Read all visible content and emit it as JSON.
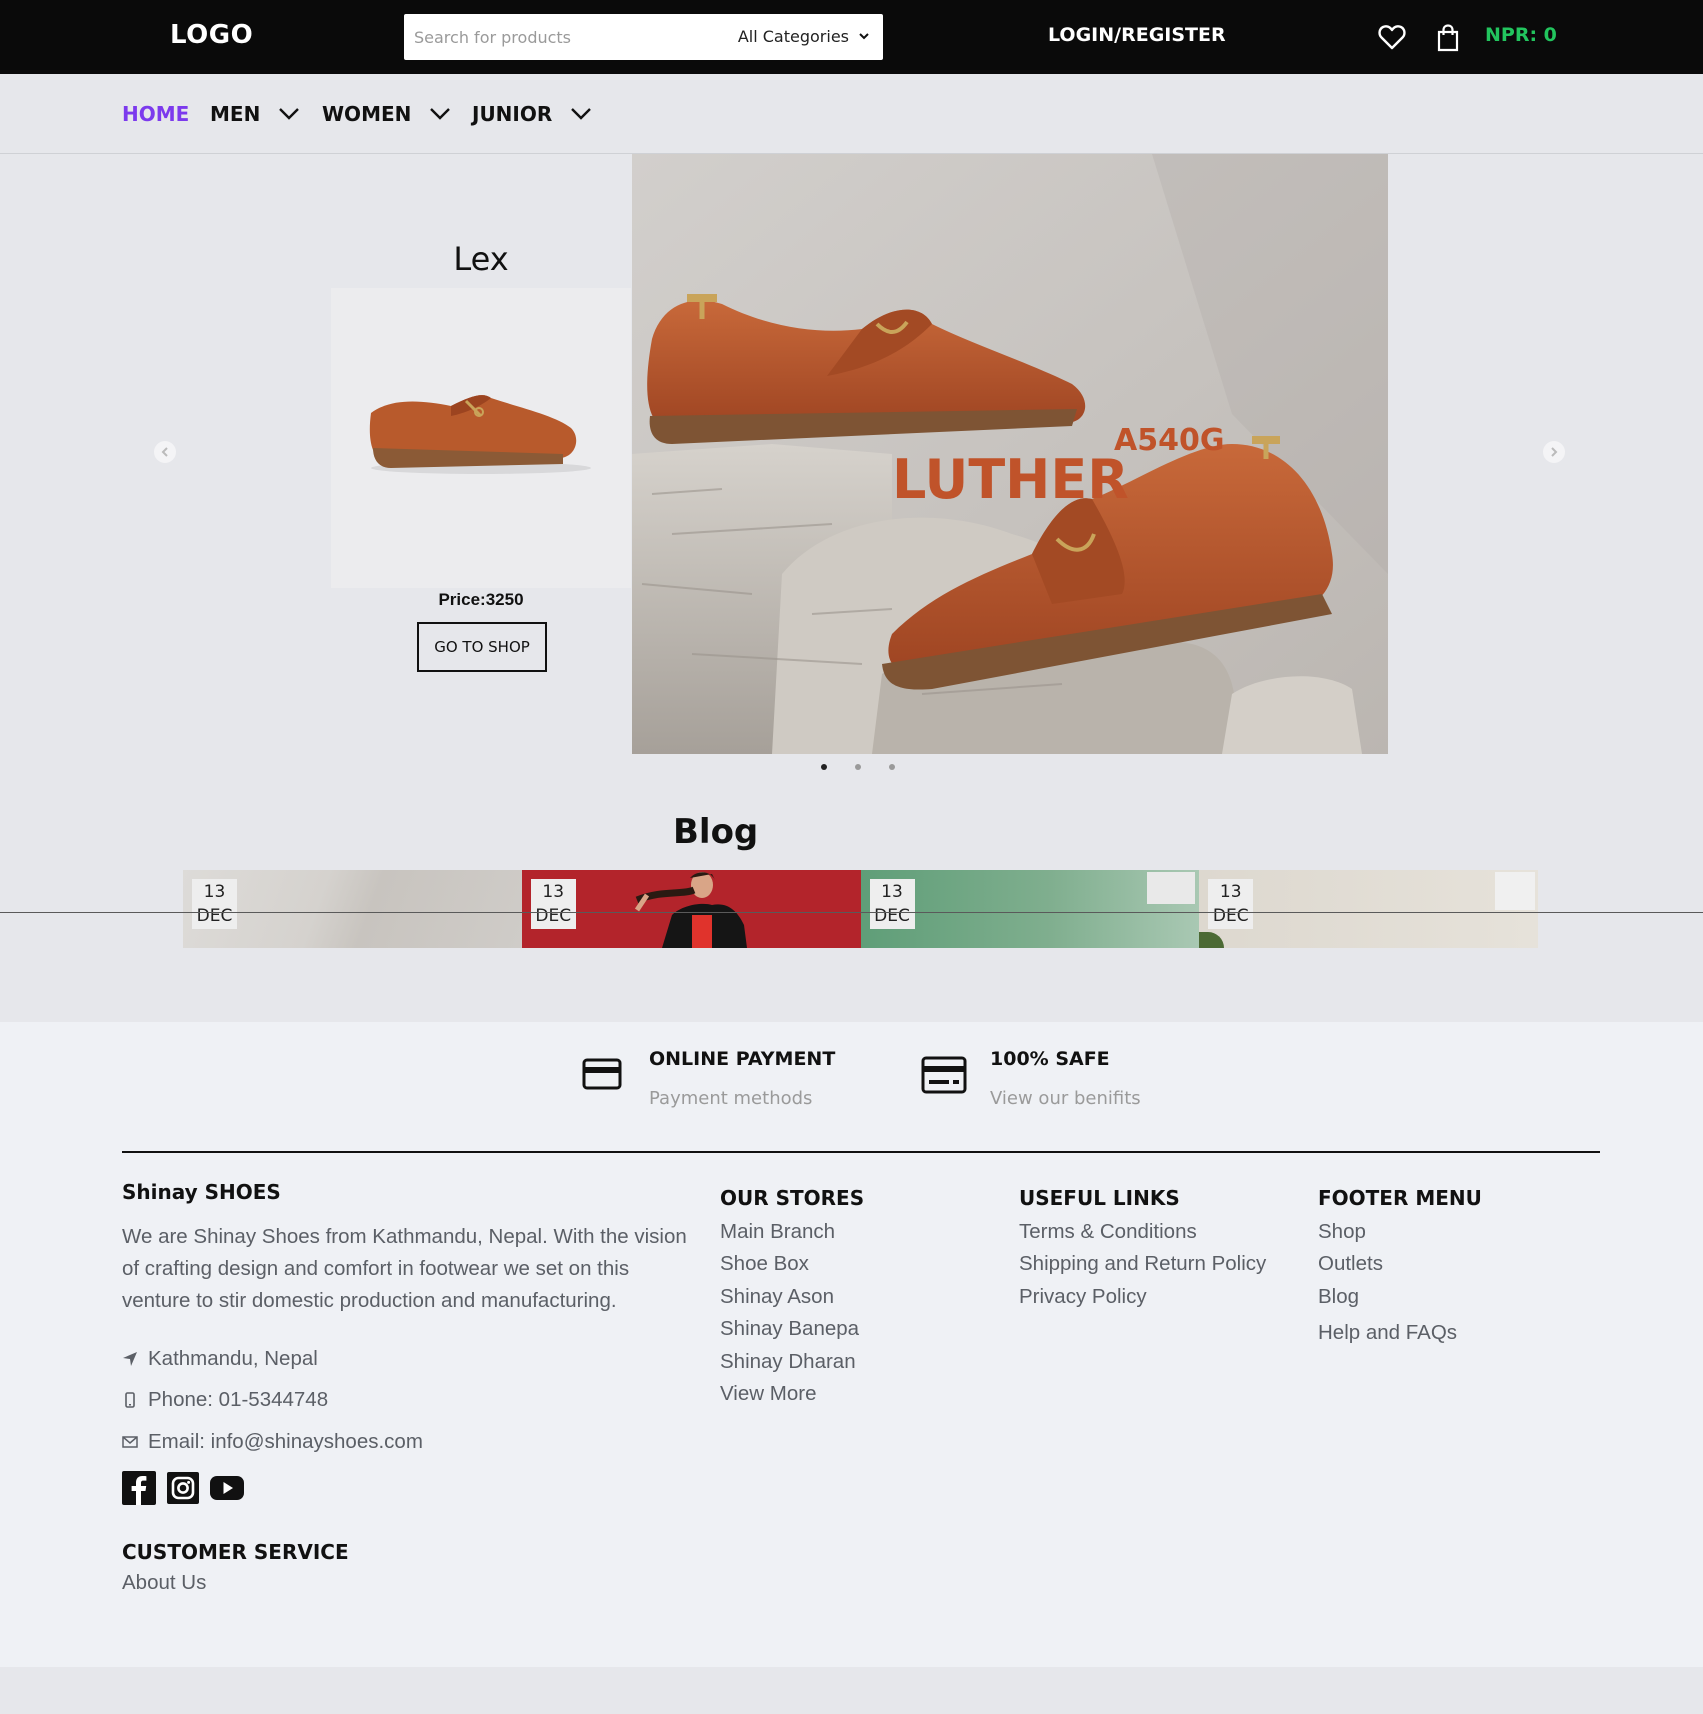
{
  "header": {
    "logo": "LOGO",
    "search_placeholder": "Search for products",
    "category": "All Categories",
    "login": "LOGIN/REGISTER",
    "cart_total": "NPR: 0",
    "accent": "#22c55e"
  },
  "nav": {
    "items": [
      {
        "label": "HOME",
        "active": true
      },
      {
        "label": "MEN",
        "active": false
      },
      {
        "label": "WOMEN",
        "active": false
      },
      {
        "label": "JUNIOR",
        "active": false
      }
    ],
    "active_color": "#7c3aed"
  },
  "slider": {
    "product_name": "Lex",
    "price": "Price:3250",
    "button": "GO TO SHOP",
    "hero_brand": "LUTHER",
    "hero_model": "A540G",
    "current_slide": 1,
    "slide_count": 3
  },
  "blog": {
    "title": "Blog",
    "posts": [
      {
        "day": "13",
        "month": "DEC"
      },
      {
        "day": "13",
        "month": "DEC"
      },
      {
        "day": "13",
        "month": "DEC"
      },
      {
        "day": "13",
        "month": "DEC"
      }
    ]
  },
  "features": [
    {
      "title": "ONLINE PAYMENT",
      "subtitle": "Payment methods",
      "icon": "credit-card-icon"
    },
    {
      "title": "100% SAFE",
      "subtitle": "View our benifits",
      "icon": "card-icon"
    }
  ],
  "footer": {
    "brand": "Shinay SHOES",
    "about": "We are Shinay Shoes from Kathmandu, Nepal. With the vision of crafting design and comfort in footwear we set on this venture to stir domestic production and manufacturing.",
    "location": "Kathmandu, Nepal",
    "phone": "Phone: 01-5344748",
    "email": "Email: info@shinayshoes.com",
    "stores_title": "OUR STORES",
    "stores": [
      "Main Branch",
      "Shoe Box",
      "Shinay Ason",
      "Shinay Banepa",
      "Shinay Dharan",
      "View More"
    ],
    "links_title": "USEFUL LINKS",
    "links": [
      "Terms & Conditions",
      "Shipping and Return Policy",
      "Privacy Policy"
    ],
    "menu_title": "FOOTER MENU",
    "menu": [
      "Shop",
      "Outlets",
      "Blog",
      "Help and FAQs"
    ],
    "service_title": "CUSTOMER SERVICE",
    "service": [
      "About Us"
    ]
  }
}
